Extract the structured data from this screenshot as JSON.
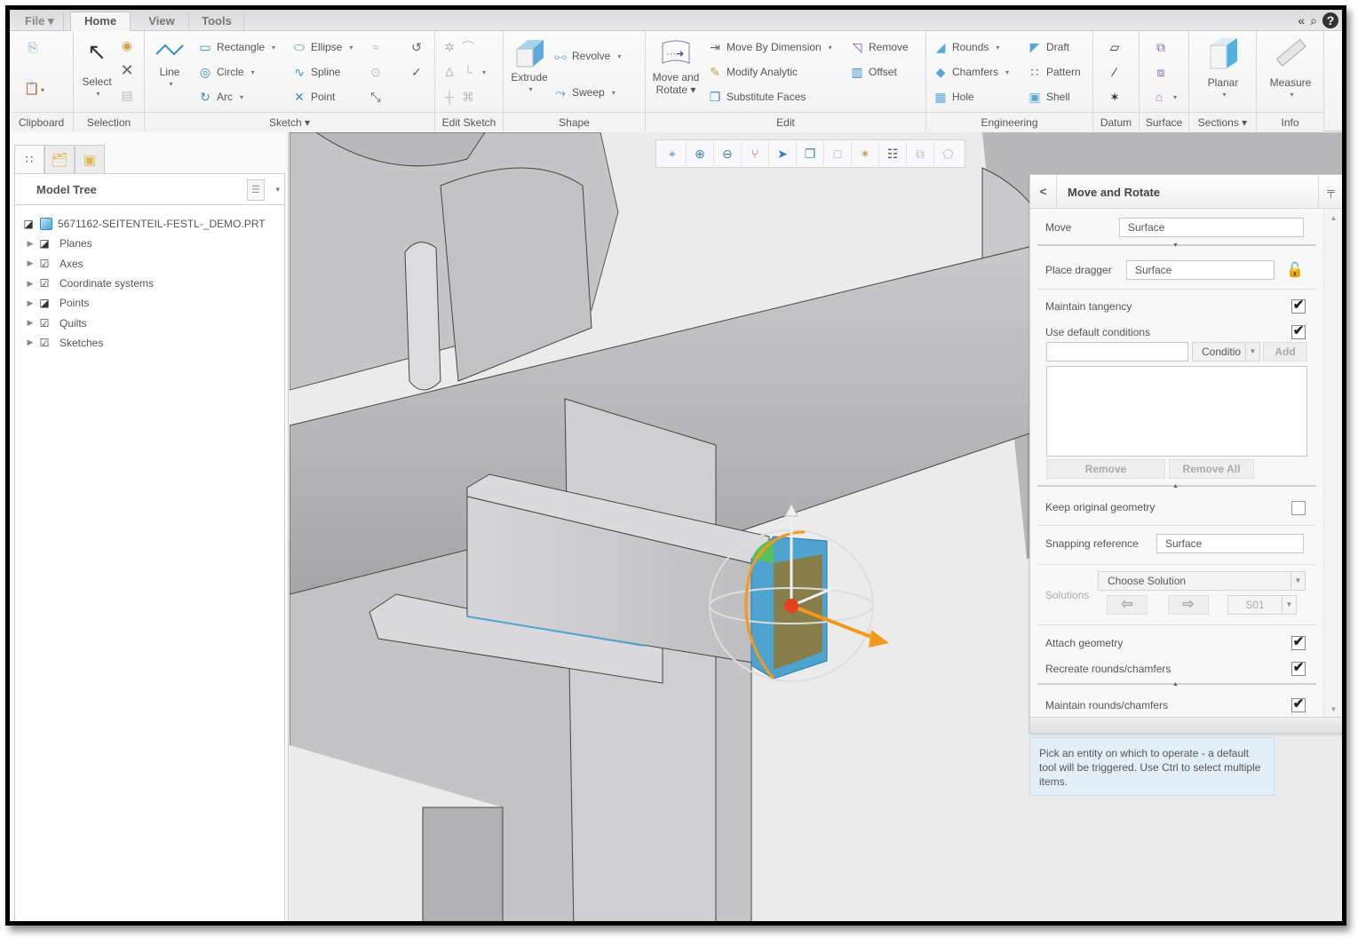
{
  "tabs": [
    {
      "label": "File ▾",
      "active": false
    },
    {
      "label": "Home",
      "active": true
    },
    {
      "label": "View",
      "active": false
    },
    {
      "label": "Tools",
      "active": false
    }
  ],
  "top_icons": {
    "collapse": "«",
    "search": "⌕",
    "help": "?"
  },
  "ribbon": {
    "groups": {
      "clipboard": "Clipboard",
      "selection": "Selection",
      "sketch": "Sketch ▾",
      "edit_sketch": "Edit Sketch",
      "shape": "Shape",
      "edit": "Edit",
      "engineering": "Engineering",
      "datum": "Datum",
      "surface": "Surface",
      "sections": "Sections ▾",
      "info": "Info"
    },
    "buttons": {
      "select": "Select",
      "line": "Line",
      "rectangle": "Rectangle",
      "circle": "Circle",
      "arc": "Arc",
      "ellipse": "Ellipse",
      "spline": "Spline",
      "point": "Point",
      "extrude": "Extrude",
      "revolve": "Revolve",
      "sweep": "Sweep",
      "move_rotate_1": "Move and",
      "move_rotate_2": "Rotate ▾",
      "move_by_dimension": "Move By Dimension",
      "modify_analytic": "Modify Analytic",
      "substitute_faces": "Substitute Faces",
      "remove": "Remove",
      "offset": "Offset",
      "rounds": "Rounds",
      "chamfers": "Chamfers",
      "hole": "Hole",
      "draft": "Draft",
      "pattern": "Pattern",
      "shell": "Shell",
      "planar": "Planar",
      "measure": "Measure"
    }
  },
  "model_tree": {
    "title": "Model Tree",
    "root": "5671162-SEITENTEIL-FESTL-_DEMO.PRT",
    "items": [
      {
        "label": "Planes",
        "check": "partial"
      },
      {
        "label": "Axes",
        "check": "checked"
      },
      {
        "label": "Coordinate systems",
        "check": "checked"
      },
      {
        "label": "Points",
        "check": "partial"
      },
      {
        "label": "Quilts",
        "check": "checked"
      },
      {
        "label": "Sketches",
        "check": "checked"
      }
    ]
  },
  "view_toolbar": [
    "refit-icon",
    "zoom-in-icon",
    "zoom-out-icon",
    "repaint-icon",
    "orient-icon",
    "display-style-icon",
    "saved-views-icon",
    "datum-display-icon",
    "annotation-display-icon",
    "spin-center-icon",
    "named-view-icon"
  ],
  "dashboard": {
    "title": "Move and Rotate",
    "move_label": "Move",
    "move_value": "Surface",
    "place_dragger_label": "Place dragger",
    "place_dragger_value": "Surface",
    "maintain_tangency": {
      "label": "Maintain tangency",
      "checked": true
    },
    "use_default_conditions": {
      "label": "Use default conditions",
      "checked": true
    },
    "condition_input": "",
    "condition_select": "Conditio",
    "add_label": "Add",
    "remove_label": "Remove",
    "remove_all_label": "Remove All",
    "keep_original": {
      "label": "Keep original geometry",
      "checked": false
    },
    "snapping_label": "Snapping reference",
    "snapping_value": "Surface",
    "solutions_label": "Solutions",
    "choose_solution": "Choose Solution",
    "solution_id": "S01",
    "attach_geometry": {
      "label": "Attach geometry",
      "checked": true
    },
    "recreate_rounds": {
      "label": "Recreate rounds/chamfers",
      "checked": true
    },
    "maintain_rounds": {
      "label": "Maintain rounds/chamfers",
      "checked": true
    }
  },
  "hint": "Pick an entity on which to operate - a default tool will be triggered. Use Ctrl to select multiple items.",
  "colors": {
    "selection_blue": "#4fa3cf",
    "dragger_orange": "#f39a1e",
    "dragger_red": "#e8401c",
    "highlight_green": "#5ac05a",
    "hint_bg": "#e2eff9"
  }
}
